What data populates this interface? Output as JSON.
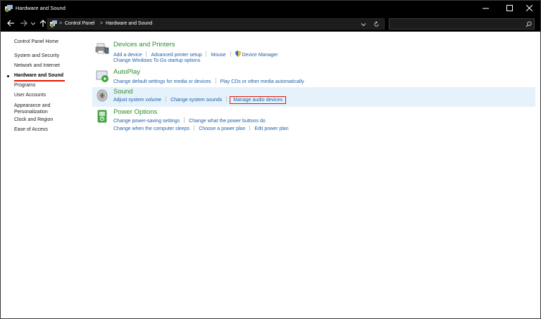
{
  "window": {
    "title": "Hardware and Sound",
    "controls": {
      "minimize": "—",
      "maximize": "☐",
      "close": "✕"
    }
  },
  "address_bar": {
    "breadcrumbs": [
      "Control Panel",
      "Hardware and Sound"
    ],
    "separator": ">",
    "search_placeholder": ""
  },
  "sidebar": {
    "items": [
      {
        "label": "Control Panel Home"
      },
      {
        "label": "System and Security"
      },
      {
        "label": "Network and Internet"
      },
      {
        "label": "Hardware and Sound",
        "selected": true
      },
      {
        "label": "Programs"
      },
      {
        "label": "User Accounts"
      },
      {
        "label": "Appearance and\nPersonalization"
      },
      {
        "label": "Clock and Region"
      },
      {
        "label": "Ease of Access"
      }
    ]
  },
  "sections": {
    "devices": {
      "heading": "Devices and Printers",
      "links_row1": [
        "Add a device",
        "Advanced printer setup",
        "Mouse",
        "Device Manager"
      ],
      "links_row2": [
        "Change Windows To Go startup options"
      ]
    },
    "autoplay": {
      "heading": "AutoPlay",
      "links_row1": [
        "Change default settings for media or devices",
        "Play CDs or other media automatically"
      ]
    },
    "sound": {
      "heading": "Sound",
      "links_row1": [
        "Adjust system volume",
        "Change system sounds",
        "Manage audio devices"
      ]
    },
    "power": {
      "heading": "Power Options",
      "links_row1": [
        "Change power-saving settings",
        "Change what the power buttons do"
      ],
      "links_row2": [
        "Change when the computer sleeps",
        "Choose a power plan",
        "Edit power plan"
      ]
    }
  },
  "colors": {
    "heading_green": "#2e8b2e",
    "link_blue": "#1f5fa8",
    "highlight_bg": "#e6f2fb",
    "annotation_red": "#e51400",
    "titlebar_bg": "#000000"
  }
}
